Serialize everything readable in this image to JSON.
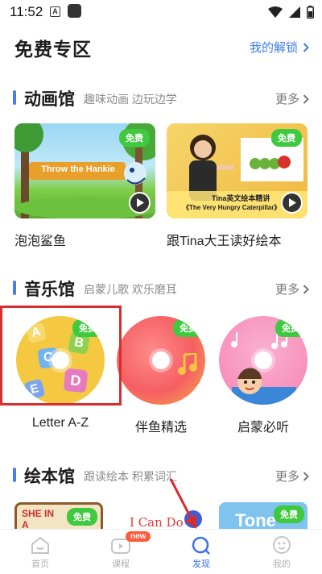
{
  "status_bar": {
    "time": "11:52",
    "a_icon": "A"
  },
  "header": {
    "title": "免费专区",
    "unlock_link": "我的解锁"
  },
  "sections": {
    "animation": {
      "title": "动画馆",
      "subtitle": "趣味动画 边玩边学",
      "more": "更多"
    },
    "music": {
      "title": "音乐馆",
      "subtitle": "启蒙儿歌 欢乐磨耳",
      "more": "更多"
    },
    "picture_book": {
      "title": "绘本馆",
      "subtitle": "跟读绘本 积累词汇",
      "more": "更多"
    }
  },
  "videos": [
    {
      "title": "泡泡鲨鱼",
      "badge": "免费",
      "thumb_text": "Throw the Hankie"
    },
    {
      "title": "跟Tina大王读好绘本",
      "badge": "免费",
      "thumb_text_1": "Tina英文绘本精讲",
      "thumb_text_2": "《The Very Hungry Caterpillar》"
    }
  ],
  "music": [
    {
      "title": "Letter A-Z",
      "badge": "免费",
      "letters": [
        "A",
        "B",
        "C",
        "D",
        "E"
      ]
    },
    {
      "title": "伴鱼精选",
      "badge": "免费"
    },
    {
      "title": "启蒙必听",
      "badge": "免费"
    }
  ],
  "books": [
    {
      "badge": "免费",
      "cover_text": "SHE IN A"
    },
    {
      "cover_text": "I Can Do"
    },
    {
      "badge": "免费",
      "cover_text": "Tone"
    }
  ],
  "bottom_nav": [
    {
      "label": "首页",
      "icon": "home-icon"
    },
    {
      "label": "课程",
      "icon": "tv-icon",
      "badge": "new"
    },
    {
      "label": "发现",
      "icon": "discover-icon",
      "active": true
    },
    {
      "label": "我的",
      "icon": "profile-icon"
    }
  ],
  "colors": {
    "accent": "#3c6ef0",
    "free_badge": "#3fc93f",
    "highlight": "#d62d2d"
  }
}
